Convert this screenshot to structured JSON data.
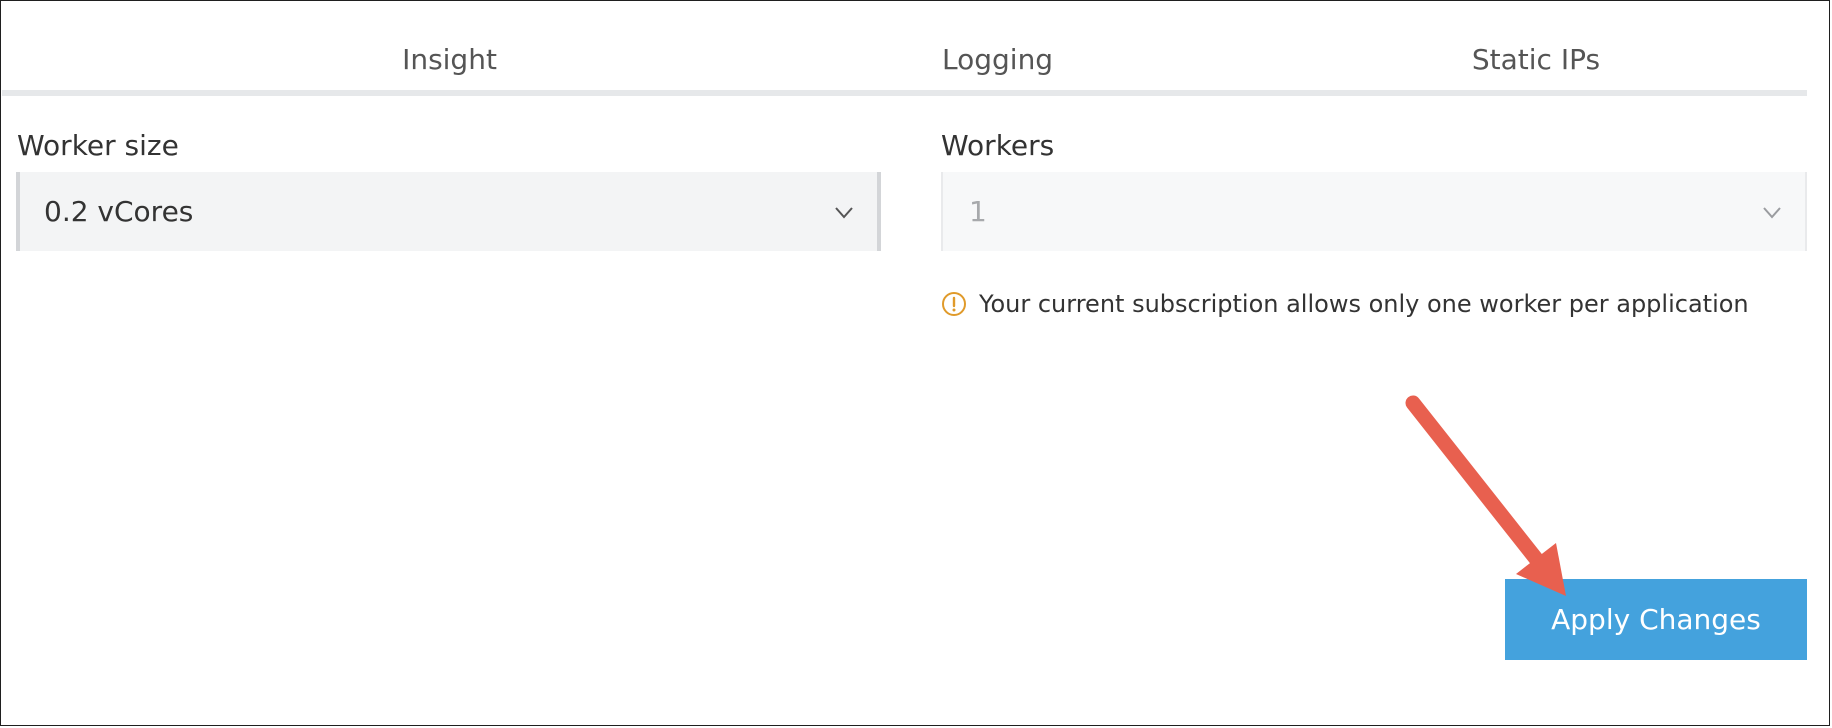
{
  "tabs": [
    {
      "label": "Insight"
    },
    {
      "label": "Logging"
    },
    {
      "label": "Static IPs"
    }
  ],
  "worker_size": {
    "label": "Worker size",
    "value": "0.2 vCores"
  },
  "workers": {
    "label": "Workers",
    "value": "1"
  },
  "warning": {
    "icon": "warning-icon",
    "text": "Your current subscription allows only one worker per application",
    "color": "#e09a2a"
  },
  "apply_button": {
    "label": "Apply Changes",
    "color": "#44a2dd"
  },
  "annotation": {
    "color": "#e8604f"
  }
}
